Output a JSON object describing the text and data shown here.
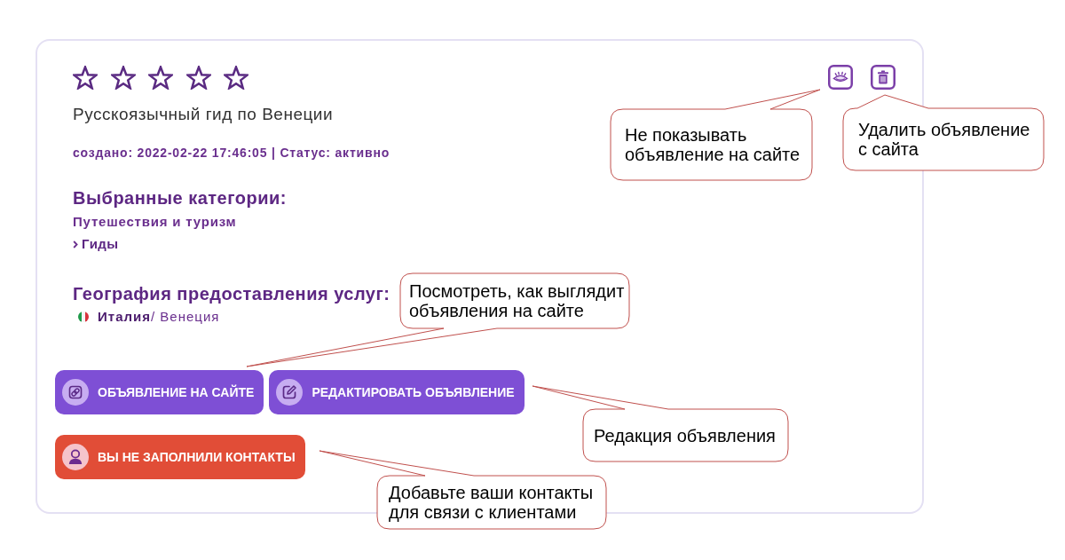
{
  "rating": {
    "stars": 0
  },
  "title": "Русскоязычный гид по Венеции",
  "meta": "создано: 2022-02-22 17:46:05 | Статус: активно",
  "categories_section": {
    "heading": "Выбранные категории:",
    "categories": [
      {
        "name": "Путешествия и туризм",
        "children": [
          {
            "name": "Гиды"
          }
        ]
      }
    ]
  },
  "geography_section": {
    "heading": "География предоставления услуг:",
    "location": "**Италия**/ Венеция"
  },
  "button_rows": [
    {
      "buttons": [
        {
          "kind": "view",
          "label": "ОБЪЯВЛЕНИЕ НА САЙТЕ"
        },
        {
          "kind": "edit",
          "label": "РЕДАКТИРОВАТЬ ОБЪЯВЛЕНИЕ"
        }
      ]
    },
    {
      "buttons": [
        {
          "kind": "contacts",
          "label": "ВЫ НЕ ЗАПОЛНИЛИ КОНТАКТЫ"
        }
      ]
    }
  ],
  "callouts": [
    {
      "text": "Не показывать\nобъявление на сайте"
    },
    {
      "text": "Удалить объявление\nс сайта"
    },
    {
      "text": "Посмотреть, как выглядит\nобъявления на сайте"
    },
    {
      "text": "Редакция объявления"
    },
    {
      "text": "Добавьте ваши контакты\nдля связи с клиентами"
    }
  ]
}
